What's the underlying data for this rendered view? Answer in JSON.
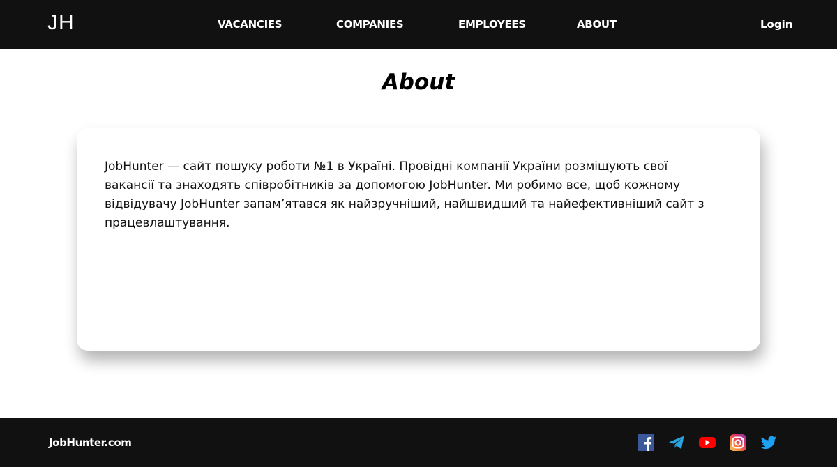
{
  "header": {
    "logo": "JH",
    "nav": {
      "vacancies": "VACANCIES",
      "companies": "COMPANIES",
      "employees": "EMPLOYEES",
      "about": "ABOUT"
    },
    "login": "Login"
  },
  "main": {
    "title": "About",
    "description": "JobHunter — сайт пошуку роботи №1 в Україні. Провідні компанії України розміщують свої вакансії та знаходять співробітників за допомогою JobHunter. Ми робимо все, щоб кожному відвідувачу JobHunter запам’ятався як найзручніший, найшвидший та найефективніший сайт з працевлаштування."
  },
  "footer": {
    "brand": "JobHunter.com",
    "social_icons": [
      "facebook-icon",
      "telegram-icon",
      "youtube-icon",
      "instagram-icon",
      "twitter-icon"
    ]
  },
  "colors": {
    "header_bg": "#111111",
    "footer_bg": "#111111",
    "page_bg": "#ffffff",
    "facebook": "#3b5998",
    "telegram": "#2aa3df",
    "youtube": "#ff0000",
    "twitter": "#1da1f2"
  }
}
